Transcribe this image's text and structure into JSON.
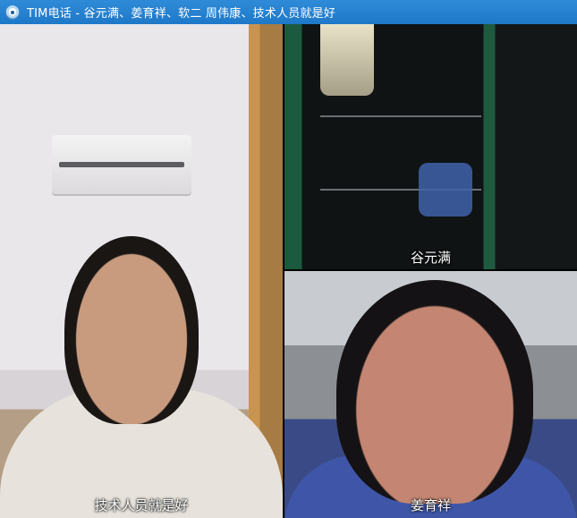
{
  "window": {
    "title": "TIM电话 - 谷元满、姜育祥、软二 周伟康、技术人员就是好",
    "app_icon": "tim-app-icon"
  },
  "videos": {
    "main": {
      "label": "技术人员就是好"
    },
    "top_right": {
      "label": "谷元满"
    },
    "bottom_right": {
      "label": "姜育祥"
    }
  }
}
